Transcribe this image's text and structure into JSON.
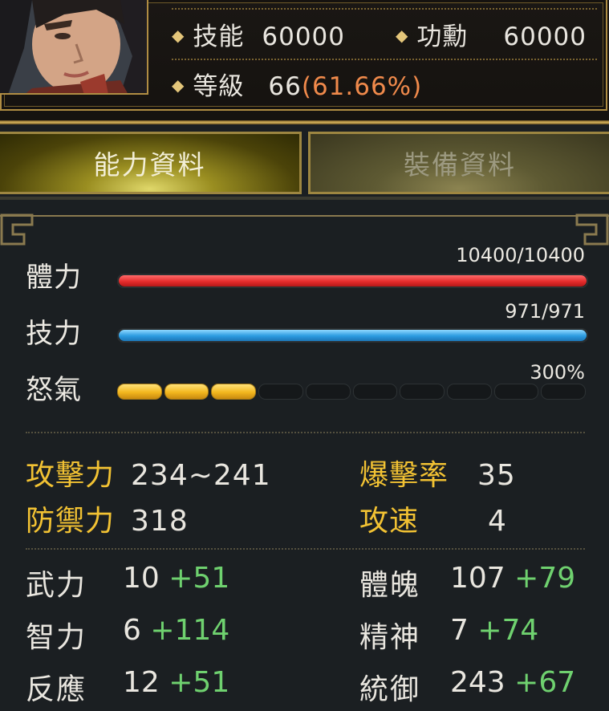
{
  "header": {
    "skill_label": "技能",
    "skill_value": "60000",
    "merit_label": "功勳",
    "merit_value": "60000",
    "level_label": "等級",
    "level_value": "66",
    "level_percent": "(61.66%)"
  },
  "tabs": [
    {
      "label": "能力資料",
      "active": true
    },
    {
      "label": "裝備資料",
      "active": false
    }
  ],
  "bars": {
    "hp": {
      "label": "體力",
      "value": "10400/10400",
      "fill": 1.0,
      "color": "#e52c2c"
    },
    "mp": {
      "label": "技力",
      "value": "971/971",
      "fill": 1.0,
      "color": "#2b9be0"
    },
    "rage": {
      "label": "怒氣",
      "value": "300%",
      "segments_total": 10,
      "segments_filled": 3,
      "color": "#f3b71e"
    }
  },
  "combat": {
    "attack_label": "攻擊力",
    "attack_value": "234~241",
    "defense_label": "防禦力",
    "defense_value": "318",
    "crit_label": "爆擊率",
    "crit_value": "35",
    "speed_label": "攻速",
    "speed_value": "4"
  },
  "attributes": [
    {
      "label": "武力",
      "base": "10",
      "bonus": "+51"
    },
    {
      "label": "智力",
      "base": "6",
      "bonus": "+114"
    },
    {
      "label": "反應",
      "base": "12",
      "bonus": "+51"
    },
    {
      "label": "體魄",
      "base": "107",
      "bonus": "+79"
    },
    {
      "label": "精神",
      "base": "7",
      "bonus": "+74"
    },
    {
      "label": "統御",
      "base": "243",
      "bonus": "+67"
    }
  ],
  "colors": {
    "accent_gold": "#f2c233",
    "bonus_green": "#6fd16f",
    "level_orange": "#f08a4b"
  }
}
